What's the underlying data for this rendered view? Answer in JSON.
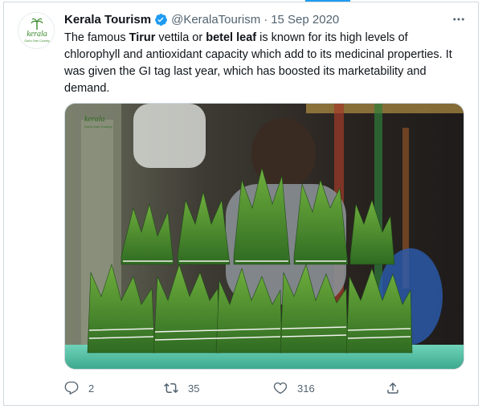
{
  "tweet": {
    "author_name": "Kerala Tourism",
    "handle": "@KeralaTourism",
    "separator": "·",
    "date": "15 Sep 2020",
    "text_parts": [
      {
        "t": "The famous ",
        "b": false
      },
      {
        "t": "Tirur",
        "b": true
      },
      {
        "t": " vettila or ",
        "b": false
      },
      {
        "t": "betel leaf",
        "b": true
      },
      {
        "t": " is known for its high levels of chlorophyll and antioxidant capacity which add to its medicinal properties. It was given the GI tag last year, which has boosted its marketability and demand.",
        "b": false
      }
    ]
  },
  "avatar": {
    "logo_text": "kerala",
    "tagline": "God's Own Country"
  },
  "media": {
    "watermark_text": "kerala",
    "watermark_tagline": "God's Own Country"
  },
  "actions": {
    "replies": "2",
    "retweets": "35",
    "likes": "316"
  },
  "colors": {
    "accent": "#1d9bf0",
    "text": "#0f1419",
    "muted": "#536471",
    "logo_green": "#3a8a2c"
  },
  "icons": [
    "verified-badge-icon",
    "more-icon",
    "reply-icon",
    "retweet-icon",
    "like-icon",
    "share-icon"
  ]
}
